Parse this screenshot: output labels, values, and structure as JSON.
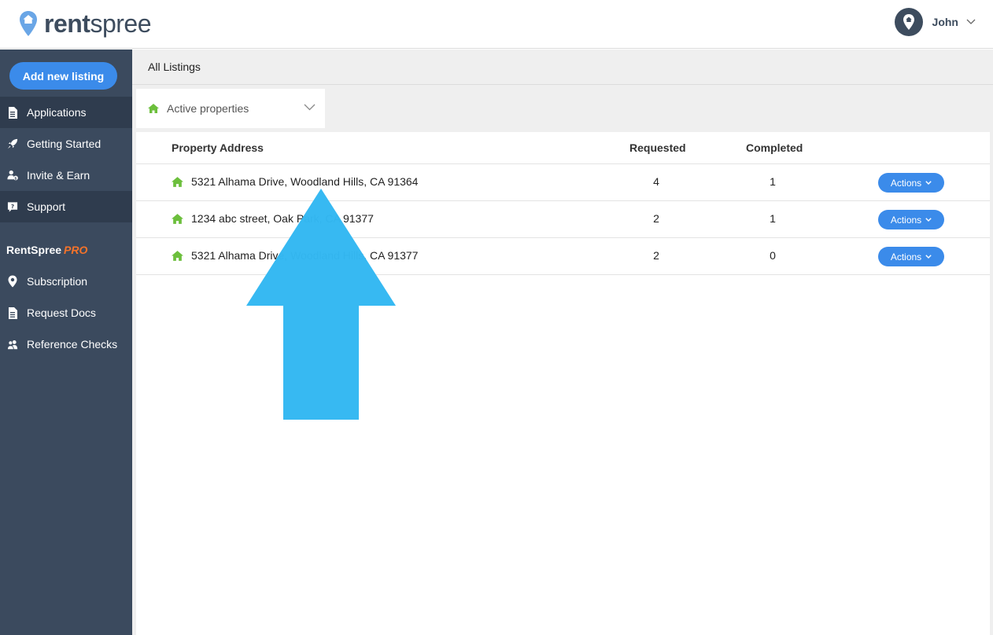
{
  "brand": {
    "name_part1": "rent",
    "name_part2": "spree",
    "accent": "#3b8bea"
  },
  "user": {
    "name": "John"
  },
  "sidebar": {
    "add_button": "Add new listing",
    "items": [
      {
        "label": "Applications",
        "icon": "document-icon"
      },
      {
        "label": "Getting Started",
        "icon": "rocket-icon"
      },
      {
        "label": "Invite & Earn",
        "icon": "user-dollar-icon"
      },
      {
        "label": "Support",
        "icon": "help-chat-icon"
      }
    ],
    "pro_heading": "RentSpree",
    "pro_badge": "PRO",
    "pro_items": [
      {
        "label": "Subscription",
        "icon": "location-pin-icon"
      },
      {
        "label": "Request Docs",
        "icon": "document-icon"
      },
      {
        "label": "Reference Checks",
        "icon": "users-icon"
      }
    ]
  },
  "main": {
    "breadcrumb": "All Listings",
    "filter": {
      "selected": "Active properties"
    },
    "table": {
      "headers": {
        "address": "Property Address",
        "requested": "Requested",
        "completed": "Completed"
      },
      "rows": [
        {
          "address": "5321 Alhama Drive, Woodland Hills, CA 91364",
          "requested": "4",
          "completed": "1",
          "action": "Actions"
        },
        {
          "address": "1234 abc street, Oak Park, CA 91377",
          "requested": "2",
          "completed": "1",
          "action": "Actions"
        },
        {
          "address": "5321 Alhama Drive, Woodland Hills, CA 91377",
          "requested": "2",
          "completed": "0",
          "action": "Actions"
        }
      ]
    }
  },
  "overlay": {
    "arrow_color": "#33b8f2"
  }
}
